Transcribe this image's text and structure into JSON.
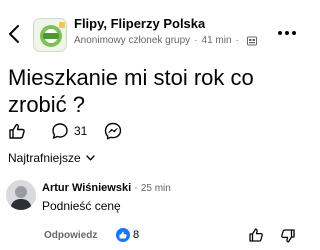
{
  "header": {
    "group_name": "Flipy, Fliperzy Polska",
    "author_label": "Anonimowy członek grupy",
    "separator": "·",
    "time": "41 min",
    "separator2": "·"
  },
  "post": {
    "text": "Mieszkanie mi stoi rok co zrobić ?"
  },
  "actions": {
    "comment_count": "31"
  },
  "sort": {
    "label": "Najtrafniejsze"
  },
  "comment": {
    "author": "Artur Wiśniewski",
    "separator": "·",
    "time": "25 min",
    "text": "Podnieść cenę",
    "reply_label": "Odpowiedz",
    "reaction_count": "8"
  },
  "colors": {
    "accent": "#1877f2",
    "secondary_text": "#65676b"
  },
  "icons": [
    "back-arrow-icon",
    "group-avatar",
    "globe-icon",
    "more-icon",
    "like-icon",
    "comment-icon",
    "share-icon",
    "chevron-down-icon",
    "like-reaction-icon",
    "thumbs-down-icon"
  ]
}
